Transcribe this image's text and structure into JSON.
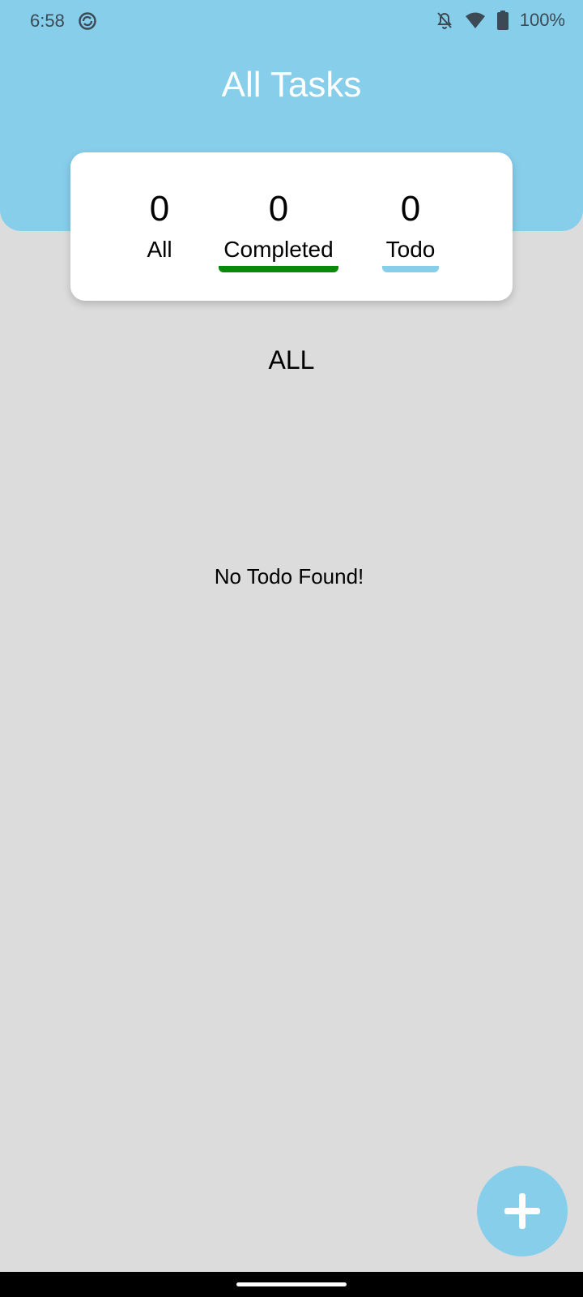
{
  "status_bar": {
    "time": "6:58",
    "battery_percent": "100%",
    "icons": [
      "sync-icon",
      "bell-off-icon",
      "wifi-icon",
      "battery-icon"
    ]
  },
  "header": {
    "title": "All Tasks",
    "color": "#87ceeb"
  },
  "stats": {
    "all": {
      "count": "0",
      "label": "All"
    },
    "completed": {
      "count": "0",
      "label": "Completed",
      "accent": "#0a8a0a"
    },
    "todo": {
      "count": "0",
      "label": "Todo",
      "accent": "#87ceeb"
    }
  },
  "list": {
    "filter_title": "ALL",
    "empty_message": "No Todo Found!"
  },
  "fab": {
    "icon": "plus-icon",
    "color": "#87ceeb"
  }
}
